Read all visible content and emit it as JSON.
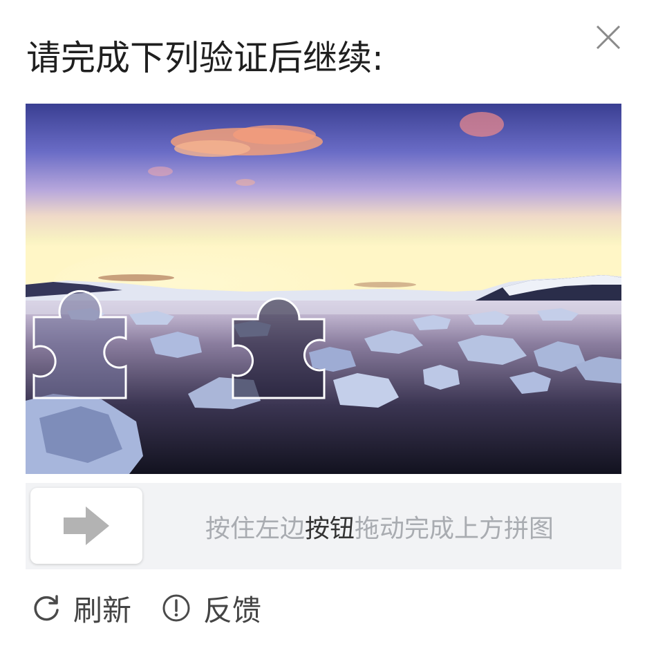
{
  "dialog": {
    "title": "请完成下列验证后继续:"
  },
  "icons": {
    "close": "close-icon",
    "arrow": "arrow-right-icon",
    "refresh": "refresh-icon",
    "feedback": "exclamation-circle-icon"
  },
  "slider": {
    "hint_prefix": "按住左边",
    "hint_strong": "按钮",
    "hint_suffix": "拖动完成上方拼图"
  },
  "footer": {
    "refresh_label": "刷新",
    "feedback_label": "反馈"
  },
  "colors": {
    "slider_track": "#f2f3f5",
    "hint_text": "#a9acb1",
    "arrow": "#b3b3b3"
  }
}
